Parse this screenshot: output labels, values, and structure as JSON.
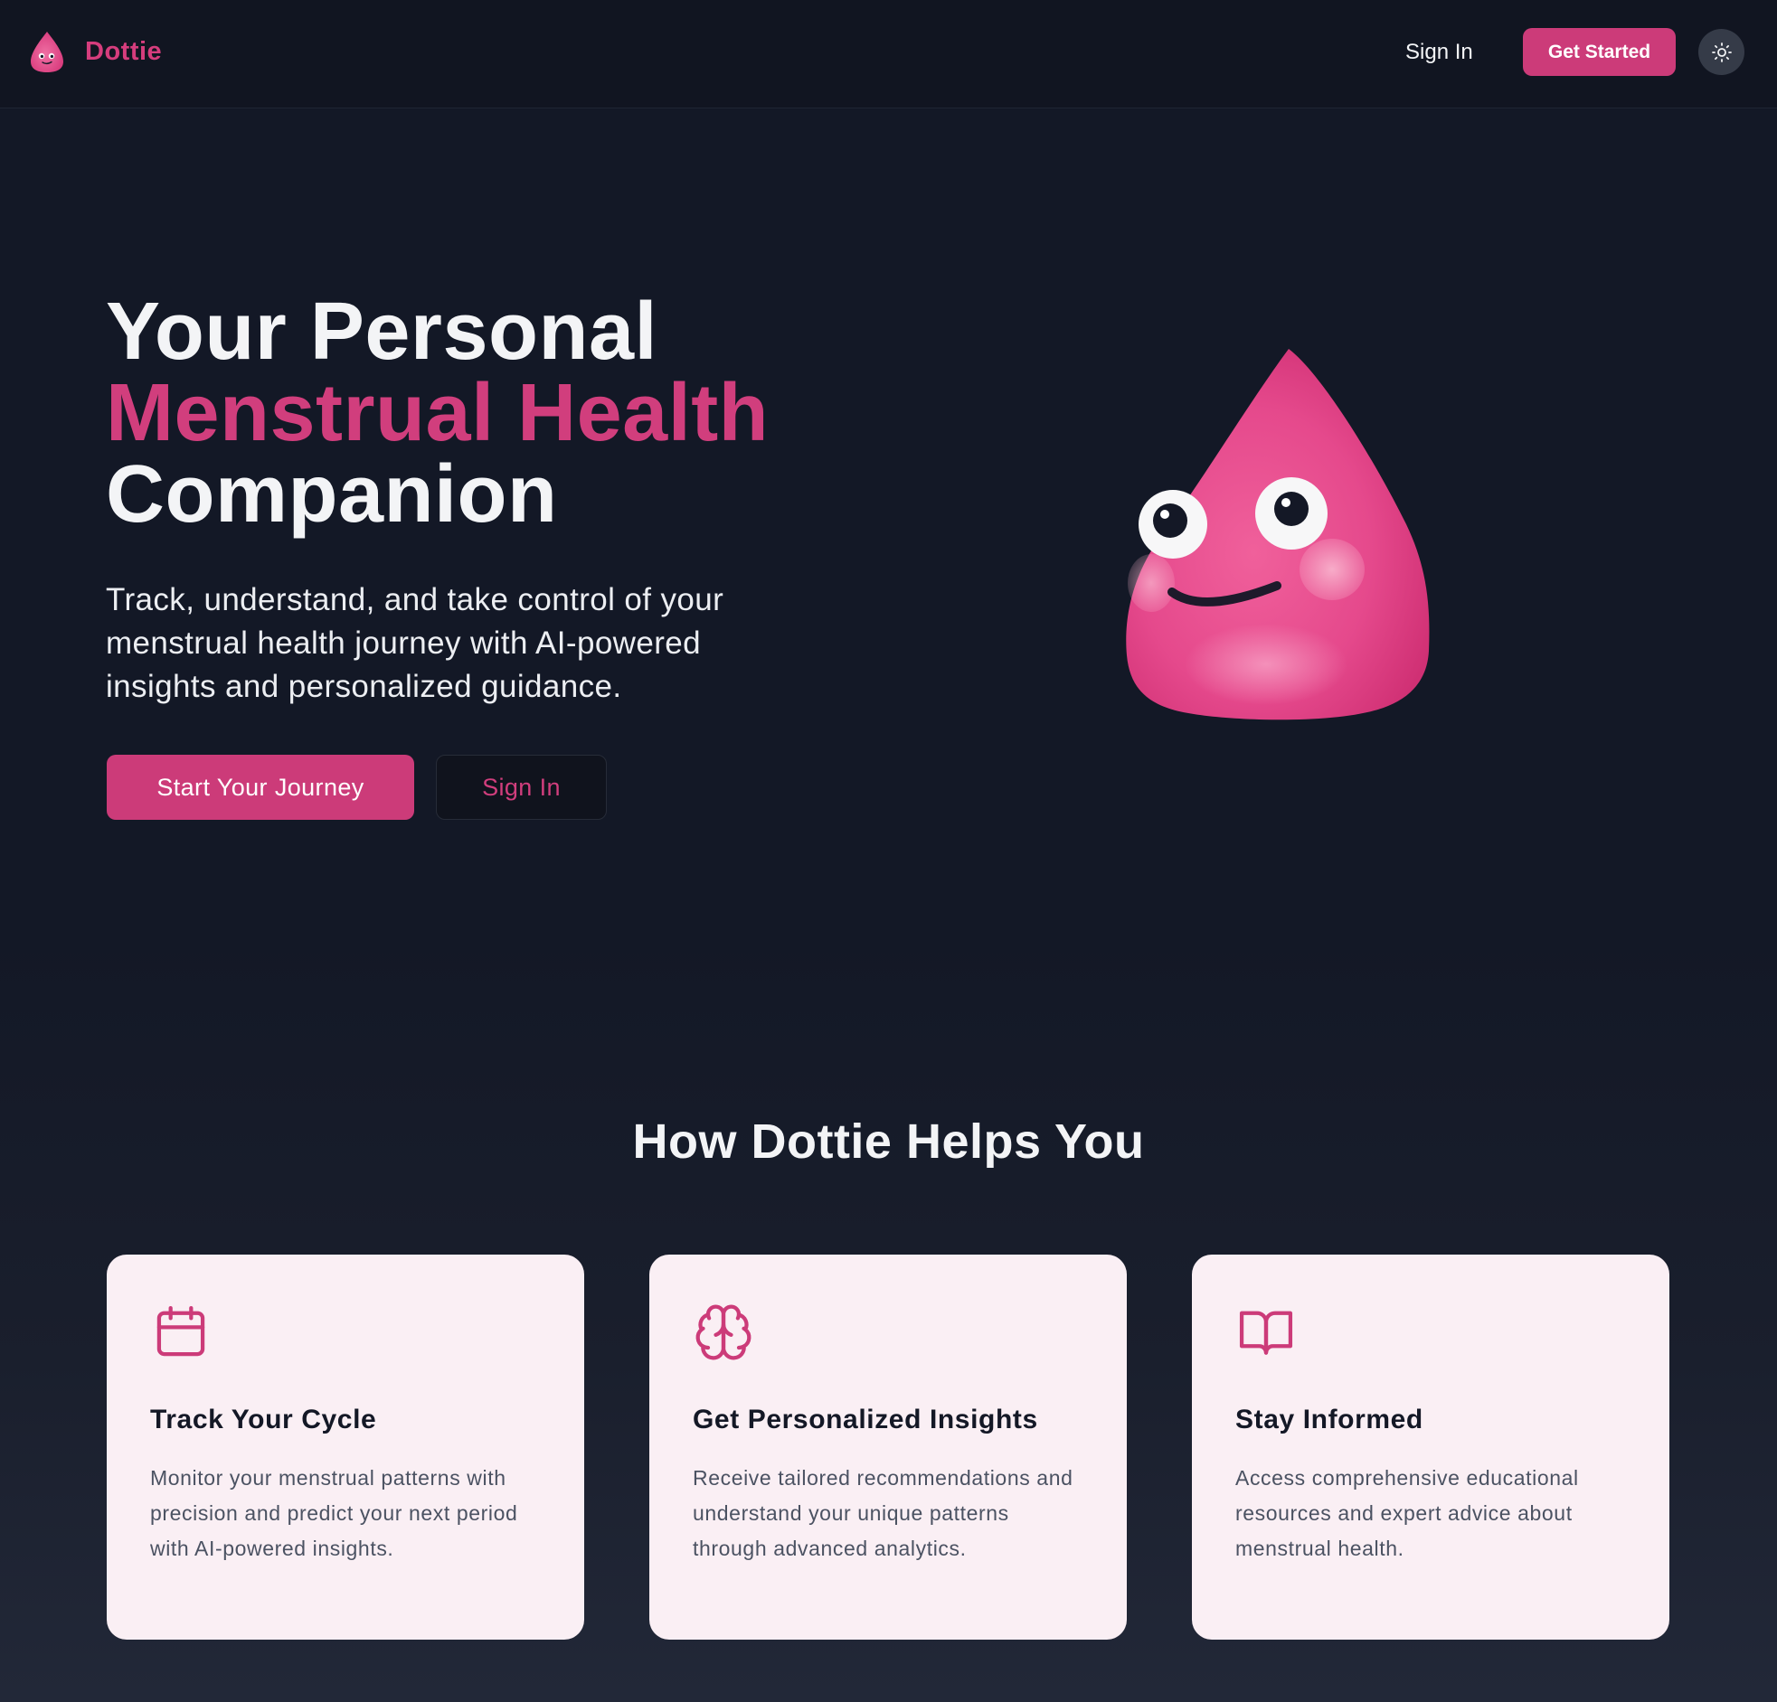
{
  "header": {
    "brand_name": "Dottie",
    "sign_in_label": "Sign In",
    "get_started_label": "Get Started",
    "theme_toggle_icon": "sun-icon"
  },
  "hero": {
    "title_line1": "Your Personal",
    "title_line2": "Menstrual Health",
    "title_line3": "Companion",
    "subtitle": "Track, understand, and take control of your menstrual health journey with AI-powered insights and personalized guidance.",
    "primary_cta": "Start Your Journey",
    "secondary_cta": "Sign In",
    "mascot": "dottie-drop-mascot"
  },
  "features": {
    "section_title": "How Dottie Helps You",
    "cards": [
      {
        "icon": "calendar-icon",
        "title": "Track Your Cycle",
        "description": "Monitor your menstrual patterns with precision and predict your next period with AI-powered insights."
      },
      {
        "icon": "brain-icon",
        "title": "Get Personalized Insights",
        "description": "Receive tailored recommendations and understand your unique patterns through advanced analytics."
      },
      {
        "icon": "book-open-icon",
        "title": "Stay Informed",
        "description": "Access comprehensive educational resources and expert advice about menstrual health."
      }
    ]
  },
  "colors": {
    "accent": "#cc3b79",
    "background": "#131826",
    "header_background": "#111521",
    "card_background": "#faeff4",
    "card_text": "#141826",
    "card_muted_text": "#4b5262"
  }
}
